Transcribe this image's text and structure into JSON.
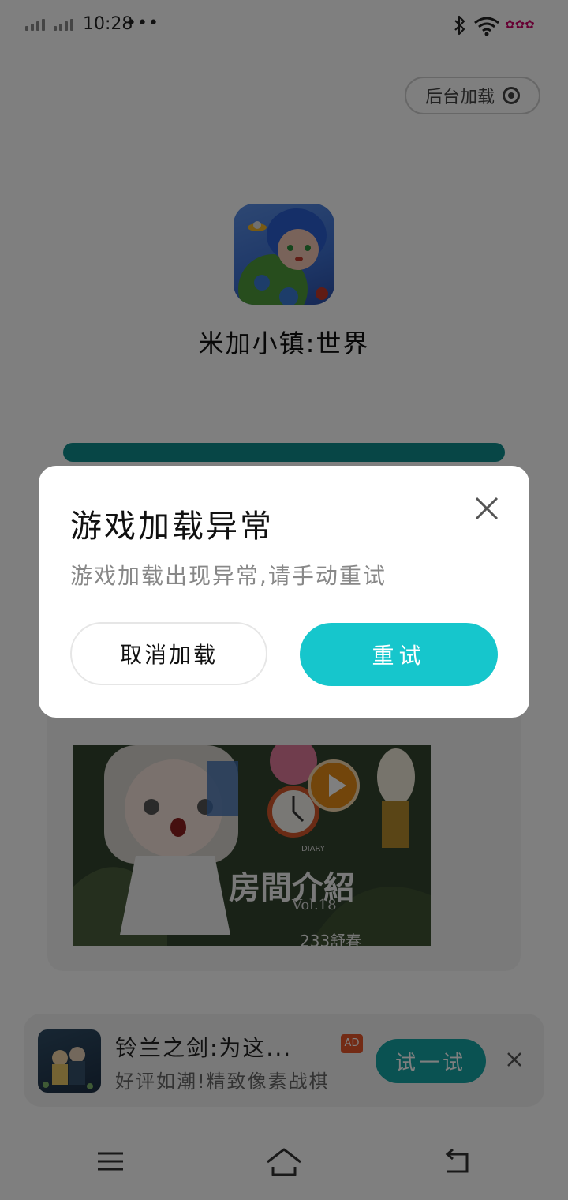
{
  "status_bar": {
    "time": "10:28",
    "more": "•••",
    "notification_icons": "✿✿✿"
  },
  "page": {
    "background_load_label": "后台加载",
    "game_title": "米加小镇:世界",
    "progress_color": "#0f8c8c"
  },
  "feed": {
    "caption": "",
    "image": {
      "diary_label": "DIARY",
      "title": "房間介紹",
      "subtitle": "Vol.18",
      "bottom_text": "233舒春"
    }
  },
  "ad": {
    "title": "铃兰之剑:为这...",
    "badge": "AD",
    "subtitle": "好评如潮!精致像素战棋",
    "button_label": "试一试"
  },
  "dialog": {
    "title": "游戏加载异常",
    "message": "游戏加载出现异常,请手动重试",
    "cancel_label": "取消加载",
    "retry_label": "重试",
    "accent_color": "#16c6cc"
  },
  "navigation": {
    "items": [
      "menu",
      "home",
      "back"
    ]
  }
}
